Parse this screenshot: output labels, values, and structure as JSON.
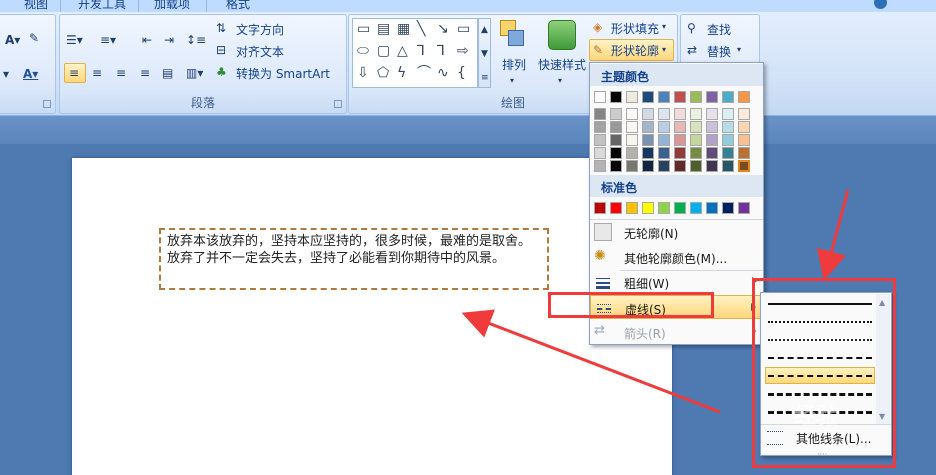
{
  "tabs": [
    "视图",
    "开发工具",
    "加载项",
    "格式"
  ],
  "ribbon": {
    "paragraph": {
      "label": "段落",
      "text_direction": "文字方向",
      "align_text": "对齐文本",
      "smartart": "转换为 SmartArt"
    },
    "drawing": {
      "label": "绘图",
      "arrange": "排列",
      "quick_styles": "快速样式",
      "shape_fill": "形状填充",
      "shape_outline": "形状轮廓"
    },
    "editing": {
      "find": "查找",
      "replace": "替换"
    }
  },
  "document": {
    "textbox": "放弃本该放弃的，坚持本应坚持的，很多时候，最难的是取舍。放弃了并不一定会失去，坚持了必能看到你期待中的风景。"
  },
  "menu": {
    "theme_colors_heading": "主题颜色",
    "standard_colors_heading": "标准色",
    "items": {
      "no_outline": "无轮廓(N)",
      "more_colors": "其他轮廓颜色(M)...",
      "weight": "粗细(W)",
      "dashes": "虚线(S)",
      "arrows": "箭头(R)"
    },
    "theme_colors": [
      "#ffffff",
      "#000000",
      "#eeece1",
      "#1f497d",
      "#4f81bd",
      "#c0504d",
      "#9bbb59",
      "#8064a2",
      "#4bacc6",
      "#f79646"
    ],
    "standard_colors": [
      "#c00000",
      "#ff0000",
      "#ffc000",
      "#ffff00",
      "#92d050",
      "#00b050",
      "#00b0f0",
      "#0070c0",
      "#002060",
      "#7030a0"
    ]
  },
  "submenu": {
    "dash_styles": [
      "solid",
      "round-dot",
      "square-dot",
      "dash",
      "dash-dot",
      "long-dash",
      "long-dash-dot"
    ],
    "selected_dash": "dash-dot",
    "more_lines": "其他线条(L)..."
  },
  "watermark": "经验",
  "colors": {
    "highlight": "#ffd67a",
    "annotation_red": "#ef3b3b",
    "document_bg": "#4e79b1"
  }
}
